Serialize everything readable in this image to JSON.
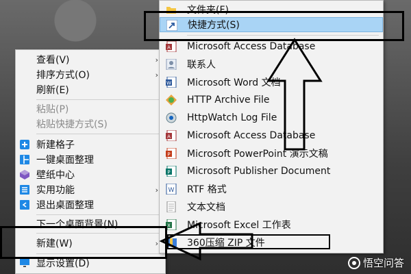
{
  "left_menu": {
    "items": [
      {
        "label": "查看(V)",
        "submenu": true
      },
      {
        "label": "排序方式(O)",
        "submenu": true
      },
      {
        "label": "刷新(E)"
      },
      {
        "label": "粘贴(P)",
        "disabled": true
      },
      {
        "label": "粘贴快捷方式(S)",
        "disabled": true
      },
      {
        "label": "新建格子",
        "icon": "plus-square-icon"
      },
      {
        "label": "一键桌面整理",
        "icon": "grid-layout-icon"
      },
      {
        "label": "壁纸中心",
        "icon": "cube-icon"
      },
      {
        "label": "实用功能",
        "icon": "list-icon",
        "submenu": true
      },
      {
        "label": "退出桌面整理",
        "icon": "exit-icon"
      },
      {
        "label": "下一个桌面背景(N)"
      },
      {
        "label": "新建(W)",
        "submenu": true,
        "highlighted": true
      },
      {
        "label": "显示设置(D)",
        "icon": "display-settings-icon"
      }
    ]
  },
  "right_menu": {
    "items": [
      {
        "label": "文件夹(F)",
        "icon": "folder-icon"
      },
      {
        "label": "快捷方式(S)",
        "icon": "shortcut-icon",
        "highlighted": true
      },
      {
        "label": "Microsoft Access Database",
        "icon": "access-icon"
      },
      {
        "label": "联系人",
        "icon": "contact-icon"
      },
      {
        "label": "Microsoft Word 文档",
        "icon": "word-icon"
      },
      {
        "label": "HTTP Archive File",
        "icon": "http-archive-icon"
      },
      {
        "label": "HttpWatch Log File",
        "icon": "httpwatch-icon"
      },
      {
        "label": "Microsoft Access Database",
        "icon": "access-icon"
      },
      {
        "label": "Microsoft PowerPoint 演示文稿",
        "icon": "powerpoint-icon"
      },
      {
        "label": "Microsoft Publisher Document",
        "icon": "publisher-icon"
      },
      {
        "label": "RTF 格式",
        "icon": "rtf-icon"
      },
      {
        "label": "文本文档",
        "icon": "text-doc-icon"
      },
      {
        "label": "Microsoft Excel 工作表",
        "icon": "excel-icon"
      },
      {
        "label": "360压缩 ZIP 文件",
        "icon": "zip-icon"
      }
    ]
  },
  "watermark": {
    "text": "悟空问答"
  },
  "colors": {
    "highlight": "#a9d4f5",
    "menu_bg": "#f2f2f2",
    "disabled": "#8a8a8a"
  }
}
